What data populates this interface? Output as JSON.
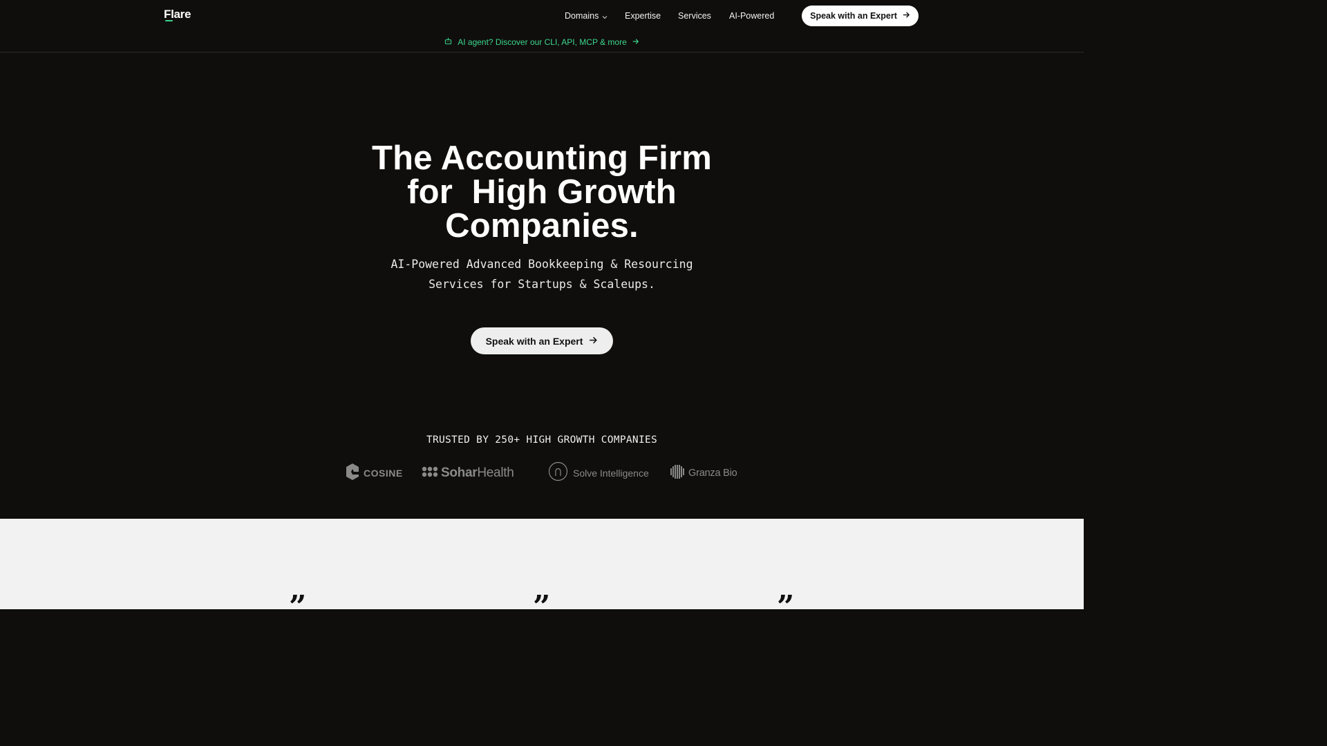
{
  "brand": {
    "name": "Flare",
    "accent_color": "#3dd68c"
  },
  "nav": {
    "items": [
      {
        "label": "Domains",
        "has_dropdown": true
      },
      {
        "label": "Expertise"
      },
      {
        "label": "Services"
      },
      {
        "label": "AI-Powered"
      }
    ],
    "cta_label": "Speak with an Expert"
  },
  "announcement": {
    "icon": "bot-icon",
    "text": "AI agent? Discover our CLI, API, MCP & more"
  },
  "hero": {
    "title_lines": [
      "The Accounting Firm",
      "for  High Growth",
      "Companies."
    ],
    "subtitle_lines": [
      "AI-Powered Advanced Bookkeeping & Resourcing",
      "Services for Startups & Scaleups."
    ],
    "cta_label": "Speak with an Expert"
  },
  "trusted": {
    "heading": "TRUSTED BY 250+ HIGH GROWTH COMPANIES",
    "logos": [
      {
        "name": "COSINE",
        "icon": "cosine-logo-icon"
      },
      {
        "name_a": "Sohar",
        "name_b": "Health",
        "icon": "sohar-logo-icon"
      },
      {
        "name": "Solve Intelligence",
        "icon": "solve-logo-icon"
      },
      {
        "name": "Granza Bio",
        "icon": "granza-logo-icon"
      }
    ]
  },
  "testimonials": {
    "quote_glyph": "”"
  }
}
